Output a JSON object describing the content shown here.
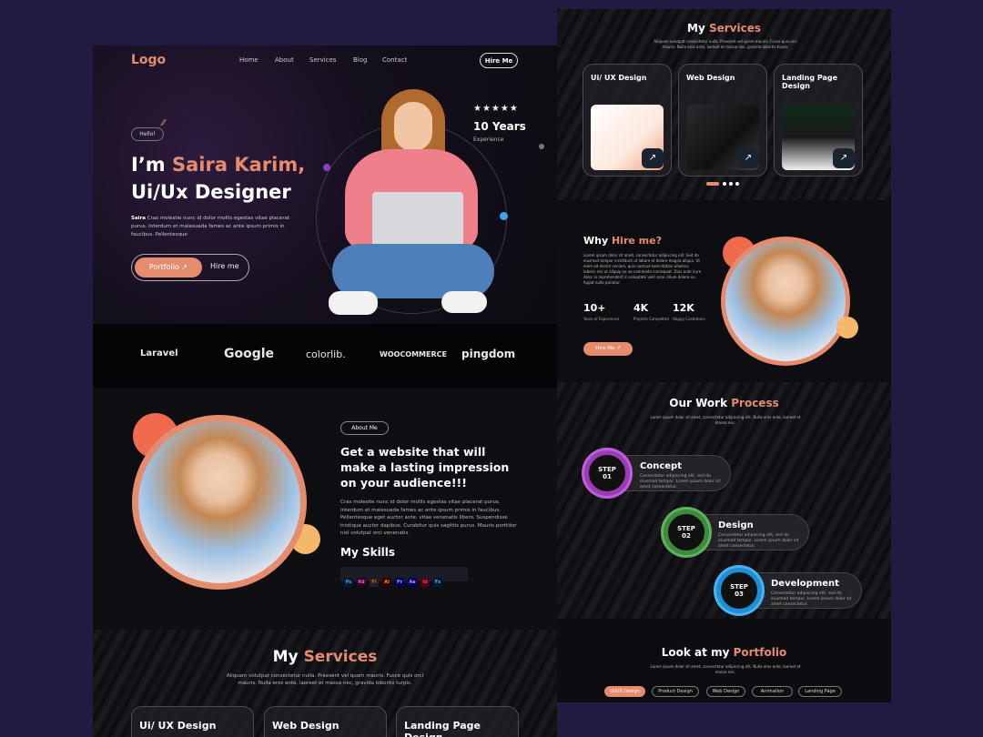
{
  "nav": {
    "logo": "Logo",
    "links": [
      "Home",
      "About",
      "Services",
      "Blog",
      "Contact"
    ],
    "cta": "Hire Me"
  },
  "hero": {
    "greeting": "Hello!",
    "title_prefix": "I’m ",
    "name": "Saira Karim,",
    "role": "Ui/Ux Designer",
    "bio_name": "Saira",
    "bio": "Cras molestie nunc id dolor mollis egestas vitae placerat purus. Interdum et malesuada fames ac ante ipsum primis in faucibus. Pellentesque",
    "portfolio_btn": "Portfolio",
    "hire_btn": "Hire me",
    "stars": "★★★★★",
    "years": "10 Years",
    "experience": "Experience"
  },
  "brands": [
    "Laravel",
    "Google",
    "colorlib.",
    "WOOCOMMERCE",
    "pingdom"
  ],
  "about": {
    "badge": "About Me",
    "heading": "Get a website that will make a lasting impression on your audience!!!",
    "body": "Cras molestie nunc id dolor mollis egestas vitae placerat purus. Interdum et malesuada fames ac ante ipsum primis in faucibus. Pellentesque eget auctor ante, vitae venenatis libero. Suspendisse tristique auctor dapibus. Curabitur quis sagittis purus. Mauris porttitor nisl volutpat orci venenatis",
    "skills_title": "My Skills",
    "skills": [
      "Ps",
      "Xd",
      "Fi",
      "Ai",
      "Pr",
      "Ae",
      "Id",
      "Fs"
    ]
  },
  "services": {
    "title_a": "My ",
    "title_b": "Services",
    "subtitle": "Aliquam volutpat consectetur nulla. Praesent vel quam mauris. Fusce quis orci mauris. Nulla eros ante, laoreet et massa nec, gravida lobortis turpis.",
    "cards": [
      "Ui/ UX Design",
      "Web Design",
      "Landing Page Design"
    ],
    "arrow": "↗"
  },
  "services_bottom": {
    "subtitle": "Aliquam volutpat consectetur nulla. Praesent vel quam mauris. Fusce quis orci mauris. Nulla eros ante, laoreet et massa nec, gravida lobortis turpis.",
    "cards": [
      "Ui/ UX Design",
      "Web Design",
      "Landing Page Design"
    ]
  },
  "why": {
    "title_a": "Why ",
    "title_b": "Hire me?",
    "body": "Lorem ipsum dolor sit amet, consectetur adipiscing elit. Sed do eiusmod tempor incididunt ut labore et dolore magna aliqua. Ut enim ad minim veniam, quis nostrud exercitation ullamco laboris nisi ut aliquip ex ea commodo consequat. Duis aute irure dolor in reprehenderit in voluptate velit esse cillum dolore eu fugiat nulla pariatur.",
    "stats": [
      {
        "num": "10+",
        "label": "Years of Experience"
      },
      {
        "num": "4K",
        "label": "Projects Completed"
      },
      {
        "num": "12K",
        "label": "Happy Customers"
      }
    ],
    "btn": "Hire Me ↗"
  },
  "process": {
    "title_a": "Our Work ",
    "title_b": "Process",
    "subtitle": "Lorem ipsum dolor sit amet, consectetur adipiscing elit. Nulla eros ante, laoreet et massa nec.",
    "steps": [
      {
        "step": "STEP",
        "num": "01",
        "title": "Concept",
        "desc": "Consectetur adipiscing elit, sed do eiusmod tempor. Lorem ipsum dolor sit amet consectetur.",
        "color": "#9b3cb7"
      },
      {
        "step": "STEP",
        "num": "02",
        "title": "Design",
        "desc": "Consectetur adipiscing elit, sed do eiusmod tempor. Lorem ipsum dolor sit amet consectetur.",
        "color": "#3b8a3e"
      },
      {
        "step": "STEP",
        "num": "03",
        "title": "Development",
        "desc": "Consectetur adipiscing elit, sed do eiusmod tempor. Lorem ipsum dolor sit amet consectetur.",
        "color": "#1d8fd6"
      }
    ]
  },
  "portfolio": {
    "title_a": "Look at my ",
    "title_b": "Portfolio",
    "subtitle": "Lorem ipsum dolor sit amet, consectetur adipiscing elit. Nulla eros ante, laoreet et massa nec.",
    "tags": [
      "UI/UX Design",
      "Product Design",
      "Web Design",
      "Animation",
      "Landing Page"
    ]
  },
  "colors": {
    "accent": "#e58b6e",
    "bg": "#0b0b10",
    "page": "#221a40",
    "yellow": "#f5b86b"
  }
}
